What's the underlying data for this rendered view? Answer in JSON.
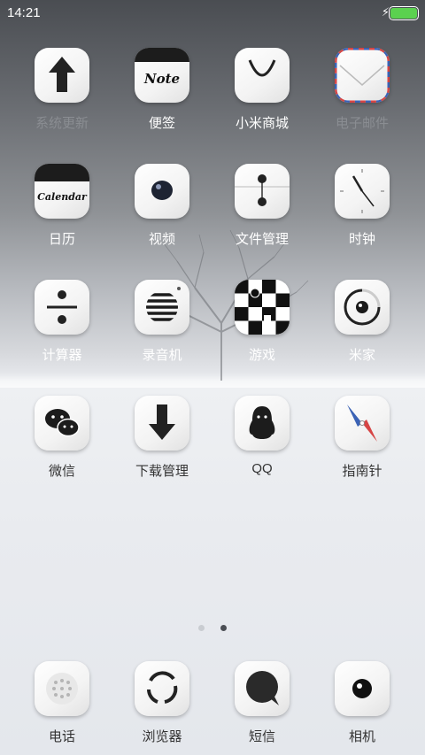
{
  "status_bar": {
    "time": "14:21",
    "charging_icon": "⚡"
  },
  "apps_row1": [
    {
      "label": "系统更新",
      "icon": "arrow-up-icon"
    },
    {
      "label": "便签",
      "icon": "note-icon",
      "icon_text": "Note"
    },
    {
      "label": "小米商城",
      "icon": "shopping-bag-icon"
    },
    {
      "label": "电子邮件",
      "icon": "envelope-icon"
    }
  ],
  "apps_row2": [
    {
      "label": "日历",
      "icon": "calendar-icon",
      "icon_text": "Calendar"
    },
    {
      "label": "视频",
      "icon": "video-lens-icon"
    },
    {
      "label": "文件管理",
      "icon": "file-folder-icon"
    },
    {
      "label": "时钟",
      "icon": "clock-icon"
    }
  ],
  "apps_row3": [
    {
      "label": "计算器",
      "icon": "calculator-icon"
    },
    {
      "label": "录音机",
      "icon": "recorder-icon"
    },
    {
      "label": "游戏",
      "icon": "checkerboard-icon"
    },
    {
      "label": "米家",
      "icon": "mijia-icon"
    }
  ],
  "apps_row4": [
    {
      "label": "微信",
      "icon": "wechat-icon"
    },
    {
      "label": "下载管理",
      "icon": "download-arrow-icon"
    },
    {
      "label": "QQ",
      "icon": "penguin-icon"
    },
    {
      "label": "指南针",
      "icon": "compass-icon"
    }
  ],
  "page_indicator": {
    "pages": 2,
    "current": 2
  },
  "dock": [
    {
      "label": "电话",
      "icon": "phone-dialpad-icon"
    },
    {
      "label": "浏览器",
      "icon": "browser-icon"
    },
    {
      "label": "短信",
      "icon": "message-bubble-icon"
    },
    {
      "label": "相机",
      "icon": "camera-lens-icon"
    }
  ],
  "colors": {
    "battery": "#5bd14f",
    "mail_red": "#d64545",
    "mail_blue": "#3a62b5"
  }
}
